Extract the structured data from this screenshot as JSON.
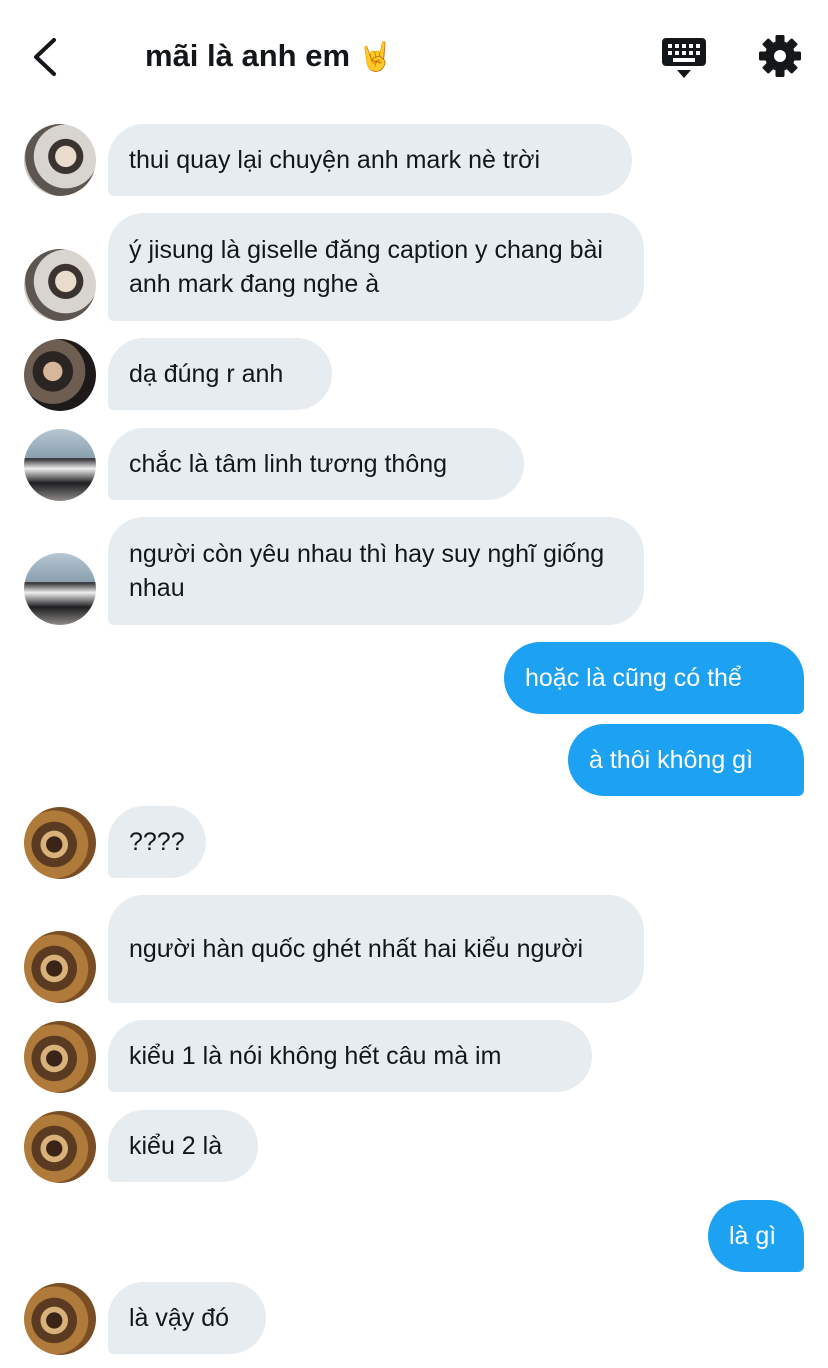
{
  "header": {
    "title": "mãi là anh em",
    "title_emoji": "🤘",
    "icons": {
      "back": "back-arrow-icon",
      "keyboard": "keyboard-icon",
      "settings": "gear-icon"
    }
  },
  "colors": {
    "incoming_bubble": "#e6ecf0",
    "outgoing_bubble": "#1da1f2",
    "text": "#14171a"
  },
  "messages": [
    {
      "direction": "in",
      "sender_avatar": "avatar-a",
      "text": "thui quay lại chuyện anh mark nè trời"
    },
    {
      "direction": "in",
      "sender_avatar": "avatar-a",
      "text": "ý jisung là giselle đăng caption y chang bài anh mark đang nghe à"
    },
    {
      "direction": "in",
      "sender_avatar": "avatar-b",
      "text": "dạ đúng r anh"
    },
    {
      "direction": "in",
      "sender_avatar": "avatar-c",
      "text": "chắc là tâm linh tương thông"
    },
    {
      "direction": "in",
      "sender_avatar": "avatar-c",
      "text": "người còn yêu nhau thì hay suy nghĩ giống nhau"
    },
    {
      "direction": "out",
      "text": "hoặc là cũng có thể"
    },
    {
      "direction": "out",
      "text": "à thôi không gì"
    },
    {
      "direction": "in",
      "sender_avatar": "avatar-d",
      "text": "????"
    },
    {
      "direction": "in",
      "sender_avatar": "avatar-d",
      "text": "người hàn quốc ghét nhất hai kiểu người"
    },
    {
      "direction": "in",
      "sender_avatar": "avatar-d",
      "text": "kiểu 1 là nói không hết câu mà im"
    },
    {
      "direction": "in",
      "sender_avatar": "avatar-d",
      "text": "kiểu 2 là"
    },
    {
      "direction": "out",
      "text": "là gì"
    },
    {
      "direction": "in",
      "sender_avatar": "avatar-d",
      "text": "là vậy đó"
    }
  ]
}
